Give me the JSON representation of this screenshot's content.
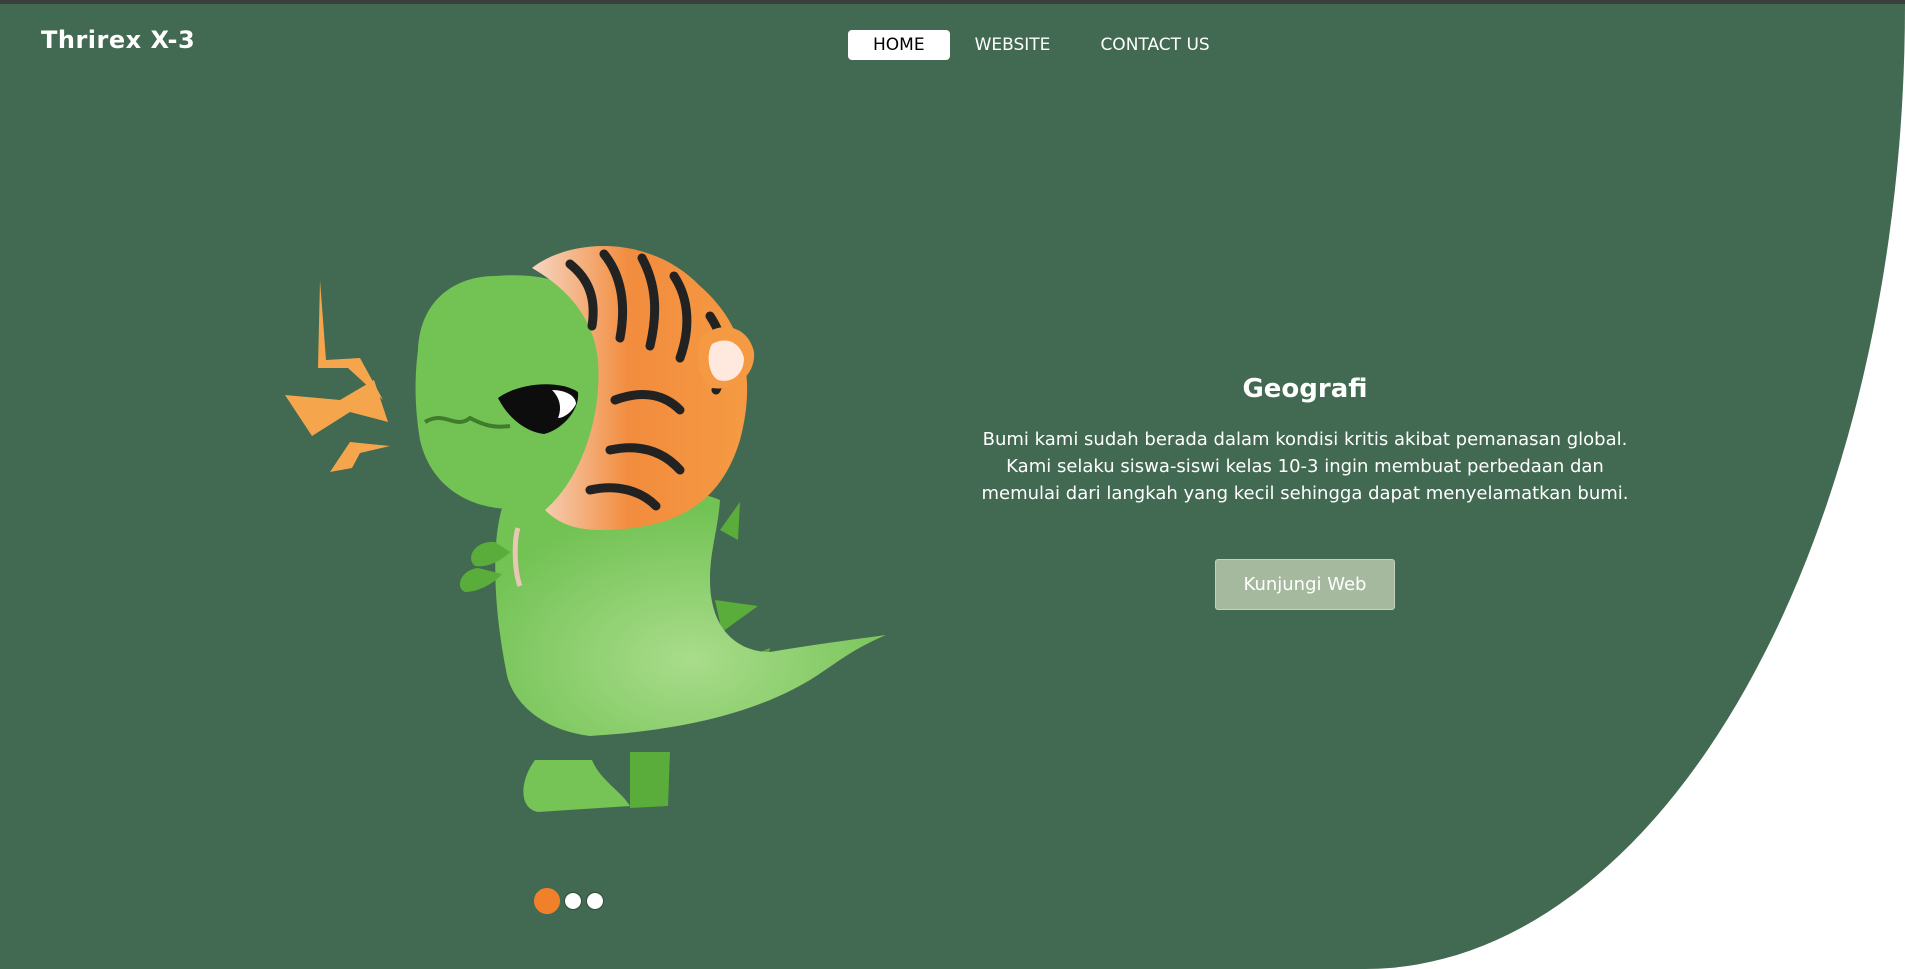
{
  "brand": "Thrirex X-3",
  "nav": {
    "items": [
      "HOME",
      "WEBSITE",
      "CONTACT US"
    ],
    "active": "HOME"
  },
  "hero": {
    "title": "Geografi",
    "lines": [
      "Bumi kami sudah berada dalam kondisi kritis akibat pemanasan global.",
      "Kami selaku siswa-siswi kelas 10-3 ingin membuat perbedaan dan",
      "memulai dari langkah yang kecil sehingga dapat menyelamatkan bumi."
    ],
    "button": "Kunjungi Web"
  },
  "carousel": {
    "total": 3,
    "active_index": 0
  },
  "colors": {
    "hero_bg": "#426951",
    "accent": "#f0812a",
    "button_bg": "#a4b99e"
  },
  "icons": {
    "illustration": "dinosaur-tiger-hood-illustration"
  }
}
